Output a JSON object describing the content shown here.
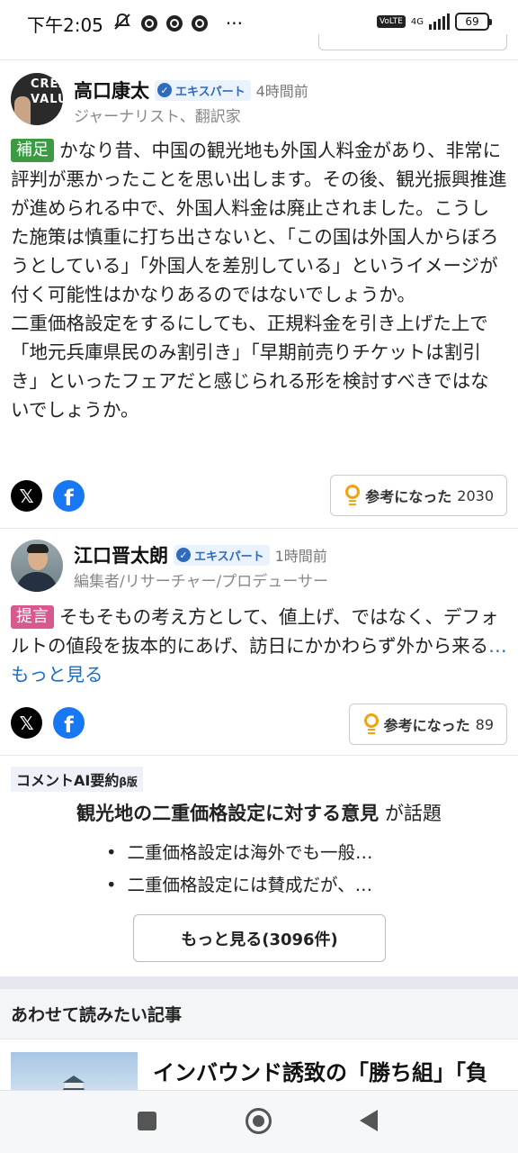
{
  "status_bar": {
    "time": "下午2:05",
    "volte": "VoLTE",
    "network": "4G",
    "battery": "69",
    "more": "···"
  },
  "comments": [
    {
      "author": "高口康太",
      "avatar_text": "CREA\nVALU",
      "badge": "エキスパート",
      "time_ago": "4時間前",
      "role": "ジャーナリスト、翻訳家",
      "tag": "補足",
      "paragraphs": [
        "かなり昔、中国の観光地も外国人料金があり、非常に評判が悪かったことを思い出します。その後、観光振興推進が進められる中で、外国人料金は廃止されました。こうした施策は慎重に打ち出さないと、「この国は外国人からぼろうとしている」「外国人を差別している」というイメージが付く可能性はかなりあるのではないでしょうか。",
        "二重価格設定をするにしても、正規料金を引き上げた上で「地元兵庫県民のみ割引き」「早期前売りチケットは割引き」といったフェアだと感じられる形を検討すべきではないでしょうか。"
      ],
      "helpful_label": "参考になった",
      "helpful_count": "2030"
    },
    {
      "author": "江口晋太朗",
      "badge": "エキスパート",
      "time_ago": "1時間前",
      "role": "編集者/リサーチャー/プロデューサー",
      "tag": "提言",
      "text": "そもそもの考え方として、値上げ、ではなく、デフォルトの値段を抜本的にあげ、訪日にかかわらず外から来る",
      "more": "…もっと見る",
      "helpful_label": "参考になった",
      "helpful_count": "89"
    }
  ],
  "share": {
    "x_glyph": "𝕏",
    "fb_glyph": "f"
  },
  "ai_summary": {
    "label": "コメントAI要約",
    "beta": "β版",
    "topic": "観光地の二重価格設定に対する意見",
    "topic_suffix": " が話題",
    "bullets": [
      "二重価格設定は海外でも一般…",
      "二重価格設定には賛成だが、…"
    ],
    "more_button": "もっと見る(3096件)"
  },
  "related": {
    "heading": "あわせて読みたい記事",
    "article_title": "インバウンド誘致の「勝ち組」「負"
  },
  "colors": {
    "tag_supplement": "#3c9a45",
    "tag_proposal": "#d65a8e",
    "expert_badge": "#2e6bbd",
    "link": "#1a6fc2",
    "bulb": "#f2a20c",
    "facebook": "#1877f2"
  },
  "icons": [
    "mute-icon",
    "chrome-icon",
    "volte-icon",
    "signal-icon",
    "battery-icon",
    "verified-icon",
    "x-icon",
    "facebook-icon",
    "bulb-icon",
    "castle-thumbnail",
    "recent-apps-icon",
    "home-icon",
    "back-icon"
  ]
}
